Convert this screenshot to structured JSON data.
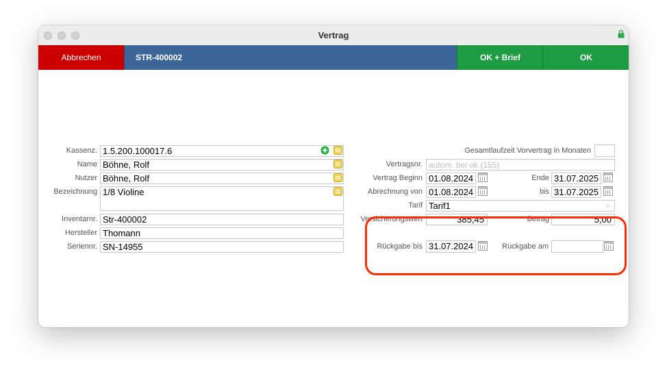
{
  "window": {
    "title": "Vertrag"
  },
  "toolbar": {
    "cancel_label": "Abbrechen",
    "contract_id": "STR-400002",
    "ok_brief_label": "OK + Brief",
    "ok_label": "OK"
  },
  "left": {
    "kassenz_label": "Kassenz.",
    "kassenz_value": "1.5.200.100017.6",
    "name_label": "Name",
    "name_value": "Böhne, Rolf",
    "nutzer_label": "Nutzer",
    "nutzer_value": "Böhne, Rolf",
    "bezeichnung_label": "Bezeichnung",
    "bezeichnung_value": "1/8 Violine",
    "inventarnr_label": "Inventarnr.",
    "inventarnr_value": "Str-400002",
    "hersteller_label": "Hersteller",
    "hersteller_value": "Thomann",
    "seriennr_label": "Seriennr.",
    "seriennr_value": "SN-14955"
  },
  "right": {
    "gesamtlaufzeit_label": "Gesamtlaufzeit Vorvertrag in Monaten",
    "gesamtlaufzeit_value": "",
    "vertragsnr_label": "Vertragsnr.",
    "vertragsnr_placeholder": "autom. bei ok (155)",
    "vertrag_beginn_label": "Vertrag Beginn",
    "vertrag_beginn_value": "01.08.2024",
    "ende_label": "Ende",
    "ende_value": "31.07.2025",
    "abrechnung_von_label": "Abrechnung von",
    "abrechnung_von_value": "01.08.2024",
    "bis_label": "bis",
    "bis_value": "31.07.2025",
    "tarif_label": "Tarif",
    "tarif_value": "Tarif1",
    "versicherungswert_label": "Versicherungswert",
    "versicherungswert_value": "385,45",
    "betrag_label": "Betrag",
    "betrag_value": "5,00",
    "rueckgabe_bis_label": "Rückgabe bis",
    "rueckgabe_bis_value": "31.07.2024",
    "rueckgabe_am_label": "Rückgabe am",
    "rueckgabe_am_value": ""
  },
  "colors": {
    "cancel": "#cc0000",
    "id_bar": "#3c6598",
    "ok": "#1e9c44",
    "highlight": "#ff2a00"
  },
  "icons": [
    "lock-icon",
    "add-icon",
    "lookup-icon",
    "calendar-icon",
    "chevron-down-icon"
  ]
}
